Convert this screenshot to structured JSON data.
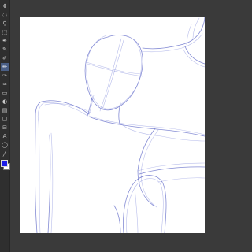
{
  "toolbar": {
    "tools": [
      {
        "name": "move-tool",
        "glyph": "✥"
      },
      {
        "name": "lasso-tool",
        "glyph": "◌"
      },
      {
        "name": "zoom-tool",
        "glyph": "⚲"
      },
      {
        "name": "rect-select-tool",
        "glyph": "⬚"
      },
      {
        "name": "pen-tool",
        "glyph": "✒"
      },
      {
        "name": "eyedropper-tool",
        "glyph": "✎"
      },
      {
        "name": "brush-tool",
        "glyph": "✐"
      },
      {
        "name": "pencil-tool",
        "glyph": "✏"
      },
      {
        "name": "airbrush-tool",
        "glyph": "✑"
      },
      {
        "name": "blend-tool",
        "glyph": "≈"
      },
      {
        "name": "eraser-tool",
        "glyph": "▭"
      },
      {
        "name": "fill-tool",
        "glyph": "◐"
      },
      {
        "name": "gradient-tool",
        "glyph": "▤"
      },
      {
        "name": "shape-tool",
        "glyph": "▢"
      },
      {
        "name": "ruler-tool",
        "glyph": "⊟"
      },
      {
        "name": "text-tool",
        "glyph": "A"
      },
      {
        "name": "balloon-tool",
        "glyph": "◯"
      },
      {
        "name": "line-tool",
        "glyph": "╱"
      }
    ],
    "active_tool": "pencil-tool"
  },
  "colors": {
    "foreground": "#1c1ce6",
    "background": "#ffffff",
    "sketch_stroke": "#5b64c6"
  }
}
